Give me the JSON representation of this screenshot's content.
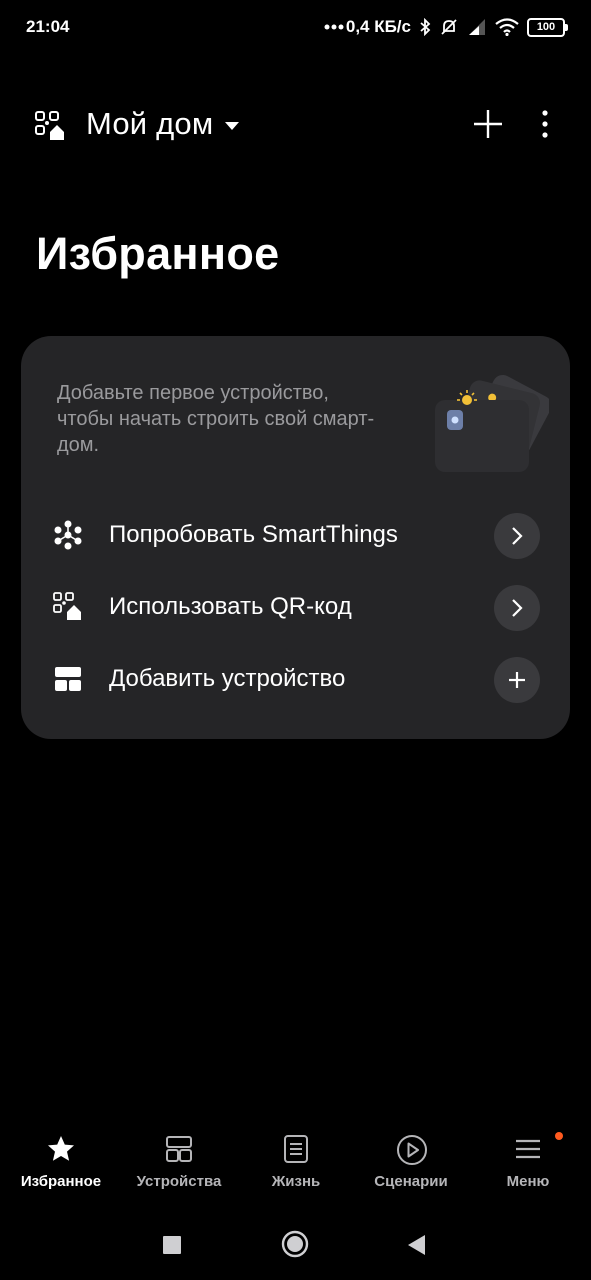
{
  "status_bar": {
    "time": "21:04",
    "network_speed": "0,4 КБ/с",
    "battery": "100",
    "icons": [
      "dots-icon",
      "bluetooth-icon",
      "mute-icon",
      "signal-icon",
      "wifi-icon",
      "battery-icon"
    ]
  },
  "header": {
    "home_name": "Мой дом",
    "icons": [
      "home-qr-icon",
      "caret-down-icon",
      "plus-icon",
      "more-vertical-icon"
    ]
  },
  "page": {
    "title": "Избранное"
  },
  "card": {
    "description": "Добавьте первое устройство, чтобы начать строить свой смарт-дом.",
    "rows": [
      {
        "label": "Попробовать SmartThings",
        "icon": "smartthings-icon",
        "action_icon": "chevron-right-icon"
      },
      {
        "label": "Использовать QR-код",
        "icon": "qr-home-icon",
        "action_icon": "chevron-right-icon"
      },
      {
        "label": "Добавить устройство",
        "icon": "devices-grid-icon",
        "action_icon": "plus-icon"
      }
    ]
  },
  "bottom_nav": {
    "items": [
      {
        "label": "Избранное",
        "icon": "star-icon",
        "active": true
      },
      {
        "label": "Устройства",
        "icon": "devices-icon",
        "active": false
      },
      {
        "label": "Жизнь",
        "icon": "life-icon",
        "active": false
      },
      {
        "label": "Сценарии",
        "icon": "play-icon",
        "active": false
      },
      {
        "label": "Меню",
        "icon": "menu-icon",
        "active": false,
        "badge": true
      }
    ]
  },
  "colors": {
    "background": "#000000",
    "card": "#252527",
    "accent_badge": "#ff5a1f",
    "muted_text": "#9a9a9d"
  }
}
